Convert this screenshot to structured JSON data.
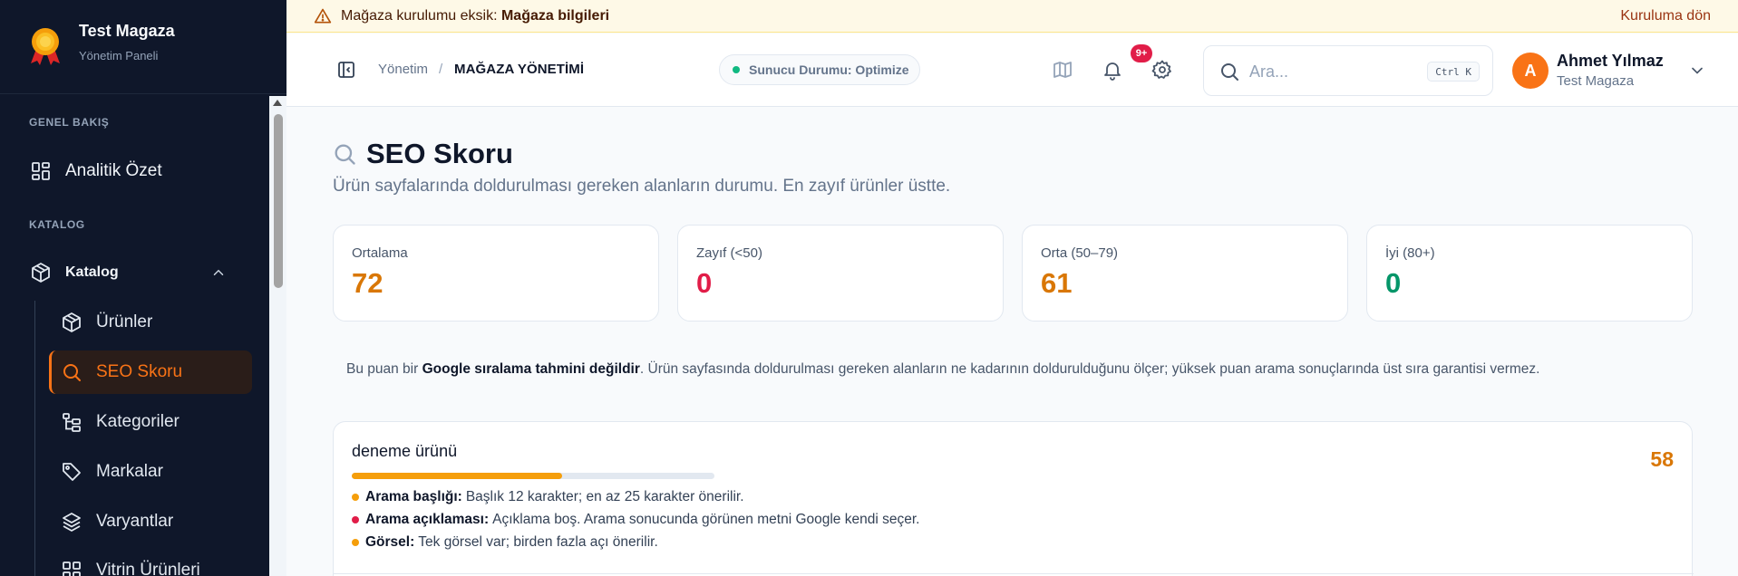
{
  "brand": {
    "title": "Test Magaza",
    "subtitle": "Yönetim Paneli"
  },
  "sidebar": {
    "section_overview": "GENEL BAKIŞ",
    "analytics": "Analitik Özet",
    "section_catalog": "KATALOG",
    "catalog_group": "Katalog",
    "items": [
      {
        "label": "Ürünler",
        "icon": "box-icon"
      },
      {
        "label": "SEO Skoru",
        "icon": "search-icon",
        "active": true
      },
      {
        "label": "Kategoriler",
        "icon": "category-tree-icon"
      },
      {
        "label": "Markalar",
        "icon": "tag-icon"
      },
      {
        "label": "Varyantlar",
        "icon": "layers-icon"
      },
      {
        "label": "Vitrin Ürünleri",
        "icon": "grid-icon"
      }
    ]
  },
  "banner": {
    "prefix": "Mağaza kurulumu eksik: ",
    "emphasis": "Mağaza bilgileri",
    "action": "Kuruluma dön"
  },
  "header": {
    "breadcrumb_parent": "Yönetim",
    "breadcrumb_sep": "/",
    "breadcrumb_current": "MAĞAZA YÖNETİMİ",
    "status": "Sunucu Durumu: Optimize",
    "notifications_badge": "9+",
    "search_placeholder": "Ara...",
    "search_shortcut": "Ctrl K",
    "user_initial": "A",
    "user_name": "Ahmet Yılmaz",
    "user_store": "Test Magaza"
  },
  "page": {
    "title": "SEO Skoru",
    "subtitle": "Ürün sayfalarında doldurulması gereken alanların durumu. En zayıf ürünler üstte."
  },
  "stats": [
    {
      "label": "Ortalama",
      "value": "72",
      "color": "#d97706"
    },
    {
      "label": "Zayıf (<50)",
      "value": "0",
      "color": "#e11d48"
    },
    {
      "label": "Orta (50–79)",
      "value": "61",
      "color": "#d97706"
    },
    {
      "label": "İyi (80+)",
      "value": "0",
      "color": "#059669"
    }
  ],
  "note": {
    "prefix": "Bu puan bir ",
    "emphasis": "Google sıralama tahmini değildir",
    "suffix": ". Ürün sayfasında doldurulması gereken alanların ne kadarının doldurulduğunu ölçer; yüksek puan arama sonuçlarında üst sıra garantisi vermez."
  },
  "products": [
    {
      "name": "deneme ürünü",
      "score": "58",
      "progress": 0.58,
      "issues": [
        {
          "label": "Arama başlığı:",
          "text": "Başlık 12 karakter; en az 25 karakter önerilir.",
          "color": "#f59e0b"
        },
        {
          "label": "Arama açıklaması:",
          "text": "Açıklama boş. Arama sonucunda görünen metni Google kendi seçer.",
          "color": "#e11d48"
        },
        {
          "label": "Görsel:",
          "text": "Tek görsel var; birden fazla açı önerilir.",
          "color": "#f59e0b"
        }
      ]
    }
  ]
}
